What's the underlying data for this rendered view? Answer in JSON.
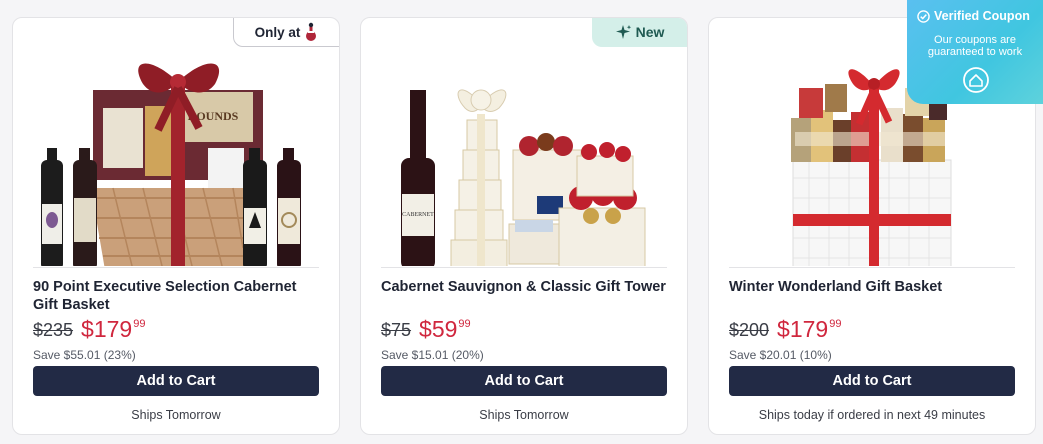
{
  "products": [
    {
      "title": "90 Point Executive Selection Cabernet Gift Basket",
      "badge": "Only at",
      "was_price": "$235",
      "price_dollars": "$179",
      "price_cents": "99",
      "savings": "Save $55.01 (23%)",
      "button": "Add to Cart",
      "shipping": "Ships Tomorrow"
    },
    {
      "title": "Cabernet Sauvignon & Classic Gift Tower",
      "badge": "New",
      "was_price": "$75",
      "price_dollars": "$59",
      "price_cents": "99",
      "savings": "Save $15.01 (20%)",
      "button": "Add to Cart",
      "shipping": "Ships Tomorrow"
    },
    {
      "title": "Winter Wonderland Gift Basket",
      "was_price": "$200",
      "price_dollars": "$179",
      "price_cents": "99",
      "savings": "Save $20.01 (10%)",
      "button": "Add to Cart",
      "shipping": "Ships today if ordered in next 49 minutes"
    }
  ],
  "coupon": {
    "title": "Verified Coupon",
    "text": "Our coupons are guaranteed to work"
  },
  "colors": {
    "button": "#222a45",
    "sale_price": "#d0273e",
    "new_badge_bg": "#d4efe9",
    "coupon_bg": "#40c6e0"
  },
  "icons": {
    "only_at": "wine-mascot-icon",
    "new": "sparkle-icon",
    "coupon_check": "check-circle-icon",
    "coupon_seal": "seal-badge-icon"
  }
}
